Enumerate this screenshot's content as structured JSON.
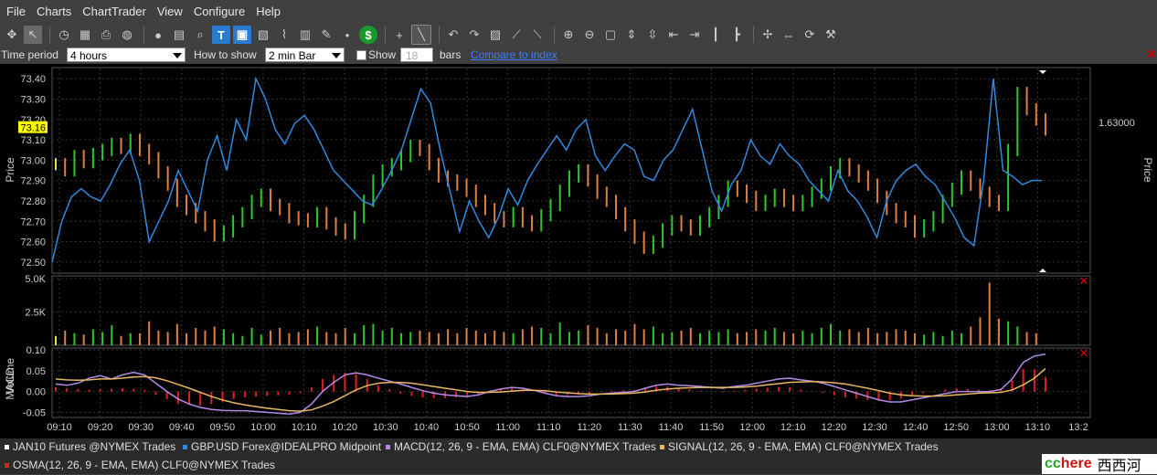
{
  "menu": [
    "File",
    "Charts",
    "ChartTrader",
    "View",
    "Configure",
    "Help"
  ],
  "toolbar_icons": [
    "crosshair-icon",
    "pointer-icon",
    "clock-icon",
    "grid-icon",
    "printer-icon",
    "globe-icon",
    "circle-icon",
    "calendar-icon",
    "magnifier-icon",
    "text-tool-icon",
    "chart-settings-icon",
    "image-icon",
    "line-chart-icon",
    "table-icon",
    "pen-icon",
    "dot-icon",
    "dollar-icon",
    "plus-icon",
    "draw-line-icon",
    "undo-icon",
    "redo-icon",
    "chart-icon",
    "tool-a-icon",
    "tool-b-icon",
    "zoom-in-icon",
    "zoom-out-icon",
    "fit-icon",
    "expand-vertical-icon",
    "compress-vertical-icon",
    "bar-left-icon",
    "bar-right-icon",
    "bars-icon",
    "bars-right-icon",
    "move-icon",
    "pan-icon",
    "refresh-icon",
    "wrench-icon"
  ],
  "options": {
    "time_period_label": "Time period",
    "time_period_value": "4 hours",
    "how_to_show_label": "How to show",
    "how_to_show_value": "2 min Bar",
    "show_label": "Show",
    "show_count": "18",
    "bars_label": "bars",
    "compare_link": "Compare to index"
  },
  "chart_data": [
    {
      "type": "bar",
      "panel": "price",
      "ylabel": "Price",
      "right_ylabel": "Price",
      "ylim": [
        72.45,
        73.45
      ],
      "yticks": [
        "73.40",
        "73.30",
        "73.20",
        "73.10",
        "73.00",
        "72.90",
        "72.80",
        "72.70",
        "72.60",
        "72.50"
      ],
      "last_price": "73.16",
      "right_axis_label": "1.63000",
      "xticks": [
        "09:10",
        "09:20",
        "09:30",
        "09:40",
        "09:50",
        "10:00",
        "10:10",
        "10:20",
        "10:30",
        "10:40",
        "10:50",
        "11:00",
        "11:10",
        "11:20",
        "11:30",
        "11:40",
        "11:50",
        "12:00",
        "12:10",
        "12:20",
        "12:30",
        "12:40",
        "12:50",
        "13:00",
        "13:10",
        "13:2"
      ],
      "series": [
        {
          "name": "JAN10 Futures @NYMEX Trades",
          "type": "bar",
          "values": [
            72.98,
            72.95,
            73.02,
            72.99,
            73.03,
            73.05,
            73.08,
            73.06,
            73.1,
            73.05,
            73.01,
            72.94,
            72.88,
            72.8,
            72.76,
            72.72,
            72.68,
            72.63,
            72.65,
            72.7,
            72.74,
            72.8,
            72.83,
            72.78,
            72.76,
            72.72,
            72.71,
            72.7,
            72.74,
            72.69,
            72.66,
            72.64,
            72.72,
            72.8,
            72.9,
            72.95,
            72.98,
            73.02,
            73.07,
            73.05,
            72.98,
            72.92,
            72.9,
            72.88,
            72.85,
            72.8,
            72.76,
            72.72,
            72.7,
            72.74,
            72.7,
            72.68,
            72.73,
            72.78,
            72.85,
            72.92,
            72.95,
            72.9,
            72.84,
            72.8,
            72.74,
            72.68,
            72.62,
            72.57,
            72.6,
            72.66,
            72.7,
            72.68,
            72.66,
            72.7,
            72.74,
            72.8,
            72.87,
            72.85,
            72.82,
            72.78,
            72.8,
            72.83,
            72.8,
            72.78,
            72.8,
            72.84,
            72.88,
            72.94,
            72.98,
            72.95,
            72.92,
            72.88,
            72.82,
            72.76,
            72.72,
            72.7,
            72.65,
            72.68,
            72.72,
            72.8,
            72.86,
            72.92,
            72.88,
            72.84,
            72.8,
            72.78,
            73.05,
            73.33,
            73.25,
            73.2,
            73.15
          ]
        },
        {
          "name": "GBP.USD Forex@IDEALPRO Midpoint",
          "type": "line",
          "values": [
            72.5,
            72.7,
            72.82,
            72.86,
            72.82,
            72.8,
            72.88,
            72.98,
            73.05,
            72.9,
            72.6,
            72.7,
            72.8,
            72.95,
            72.85,
            72.75,
            73.0,
            73.12,
            72.95,
            73.2,
            73.1,
            73.4,
            73.3,
            73.15,
            73.08,
            73.18,
            73.22,
            73.15,
            73.05,
            72.95,
            72.9,
            72.85,
            72.8,
            72.78,
            72.86,
            72.95,
            73.05,
            73.2,
            73.35,
            73.28,
            73.05,
            72.85,
            72.65,
            72.8,
            72.7,
            72.62,
            72.72,
            72.86,
            72.78,
            72.9,
            72.98,
            73.05,
            73.12,
            73.05,
            73.15,
            73.2,
            73.02,
            72.95,
            73.02,
            73.08,
            73.05,
            72.92,
            72.9,
            73.0,
            73.05,
            73.15,
            73.25,
            73.05,
            72.85,
            72.75,
            72.88,
            72.95,
            73.1,
            73.02,
            72.98,
            73.08,
            73.02,
            72.98,
            72.9,
            72.85,
            72.8,
            72.95,
            72.85,
            72.8,
            72.72,
            72.62,
            72.8,
            72.9,
            72.95,
            72.98,
            72.92,
            72.88,
            72.8,
            72.72,
            72.62,
            72.58,
            72.9,
            73.4,
            72.95,
            72.92,
            72.88,
            72.9,
            72.9
          ]
        }
      ]
    },
    {
      "type": "bar",
      "panel": "volume",
      "ylabel": "Volume",
      "ylim": [
        0,
        5000
      ],
      "yticks": [
        "5.0K",
        "2.5K"
      ],
      "series": [
        {
          "name": "Volume",
          "values": [
            700,
            1100,
            900,
            800,
            1200,
            1000,
            1500,
            700,
            900,
            900,
            1800,
            1100,
            1000,
            1600,
            900,
            1300,
            1100,
            1400,
            1200,
            900,
            700,
            1300,
            800,
            1100,
            1300,
            900,
            1000,
            1200,
            1400,
            1000,
            900,
            1300,
            900,
            1500,
            1600,
            1100,
            1300,
            900,
            1000,
            1100,
            1000,
            900,
            1200,
            900,
            1300,
            1100,
            900,
            1100,
            1000,
            900,
            1200,
            1400,
            1300,
            900,
            1700,
            1000,
            1100,
            1500,
            1300,
            900,
            1200,
            1100,
            1600,
            1200,
            1400,
            900,
            1000,
            1100,
            1300,
            900,
            1100,
            1000,
            1200,
            900,
            1000,
            1200,
            1100,
            1300,
            1000,
            900,
            1100,
            900,
            1300,
            1600,
            1100,
            1200,
            1000,
            1300,
            900,
            1000,
            1200,
            1100,
            900,
            800,
            1000,
            700,
            1100,
            900,
            1400,
            2100,
            4700,
            2000,
            1800,
            1400,
            1000,
            900
          ]
        }
      ]
    },
    {
      "type": "line",
      "panel": "macd",
      "ylabel": "MACD",
      "ylim": [
        -0.06,
        0.1
      ],
      "yticks": [
        "0.10",
        "0.05",
        "0.00",
        "-0.05"
      ],
      "series": [
        {
          "name": "MACD(12, 26, 9 - EMA, EMA) CLF0@NYMEX Trades",
          "values": [
            0.018,
            0.015,
            0.02,
            0.032,
            0.038,
            0.03,
            0.04,
            0.046,
            0.04,
            0.02,
            0.0,
            -0.018,
            -0.03,
            -0.038,
            -0.043,
            -0.045,
            -0.046,
            -0.046,
            -0.048,
            -0.05,
            -0.052,
            -0.054,
            -0.05,
            -0.03,
            0.0,
            0.022,
            0.04,
            0.045,
            0.04,
            0.032,
            0.025,
            0.018,
            0.01,
            0.002,
            -0.004,
            -0.008,
            -0.01,
            -0.012,
            -0.008,
            0.0,
            0.006,
            0.01,
            0.008,
            0.003,
            -0.004,
            -0.01,
            -0.012,
            -0.012,
            -0.01,
            -0.006,
            -0.004,
            -0.002,
            0.0,
            0.008,
            0.015,
            0.018,
            0.015,
            0.014,
            0.012,
            0.01,
            0.008,
            0.012,
            0.015,
            0.02,
            0.025,
            0.03,
            0.032,
            0.028,
            0.025,
            0.02,
            0.012,
            0.004,
            -0.004,
            -0.012,
            -0.02,
            -0.025,
            -0.025,
            -0.02,
            -0.015,
            -0.01,
            -0.005,
            0.0,
            0.0,
            0.0,
            0.0,
            0.005,
            0.03,
            0.07,
            0.085,
            0.09
          ]
        },
        {
          "name": "SIGNAL(12, 26, 9 - EMA, EMA) CLF0@NYMEX Trades",
          "values": [
            0.03,
            0.028,
            0.027,
            0.028,
            0.03,
            0.03,
            0.032,
            0.035,
            0.036,
            0.033,
            0.026,
            0.017,
            0.008,
            -0.002,
            -0.012,
            -0.02,
            -0.027,
            -0.032,
            -0.036,
            -0.04,
            -0.043,
            -0.046,
            -0.047,
            -0.044,
            -0.035,
            -0.024,
            -0.01,
            0.004,
            0.014,
            0.02,
            0.022,
            0.022,
            0.02,
            0.016,
            0.012,
            0.008,
            0.004,
            0.0,
            -0.002,
            -0.002,
            -0.001,
            0.001,
            0.003,
            0.003,
            0.002,
            -0.001,
            -0.003,
            -0.005,
            -0.006,
            -0.006,
            -0.006,
            -0.005,
            -0.004,
            -0.001,
            0.003,
            0.006,
            0.008,
            0.009,
            0.01,
            0.01,
            0.01,
            0.01,
            0.011,
            0.013,
            0.016,
            0.019,
            0.022,
            0.023,
            0.024,
            0.023,
            0.021,
            0.018,
            0.013,
            0.008,
            0.002,
            -0.004,
            -0.008,
            -0.01,
            -0.011,
            -0.011,
            -0.01,
            -0.008,
            -0.006,
            -0.004,
            -0.003,
            -0.002,
            0.004,
            0.016,
            0.032,
            0.055
          ]
        },
        {
          "name": "OSMA(12, 26, 9 - EMA, EMA) CLF0@NYMEX Trades",
          "values": [
            0.01,
            0.008,
            0.006,
            0.004,
            0.005,
            0.006,
            0.008,
            0.006,
            0.004,
            -0.008,
            -0.018,
            -0.03,
            -0.032,
            -0.034,
            -0.03,
            -0.025,
            -0.018,
            -0.014,
            -0.012,
            -0.01,
            -0.009,
            -0.008,
            -0.004,
            0.01,
            0.03,
            0.04,
            0.045,
            0.042,
            0.03,
            0.015,
            0.005,
            -0.005,
            -0.01,
            -0.014,
            -0.016,
            -0.016,
            -0.014,
            -0.012,
            -0.006,
            0.002,
            0.007,
            0.009,
            0.005,
            0.0,
            -0.006,
            -0.009,
            -0.009,
            -0.007,
            -0.004,
            0.0,
            0.002,
            0.003,
            0.004,
            0.009,
            0.012,
            0.012,
            0.007,
            0.005,
            0.002,
            0.0,
            -0.002,
            0.002,
            0.004,
            0.007,
            0.009,
            0.011,
            0.01,
            0.005,
            0.001,
            -0.003,
            -0.009,
            -0.014,
            -0.017,
            -0.02,
            -0.022,
            -0.021,
            -0.017,
            -0.01,
            -0.004,
            0.001,
            0.005,
            0.008,
            0.006,
            0.004,
            0.003,
            0.007,
            0.026,
            0.054,
            0.053,
            0.035
          ]
        }
      ]
    }
  ],
  "legend": [
    {
      "label": "JAN10 Futures @NYMEX Trades",
      "color": "#ffffff"
    },
    {
      "label": "GBP.USD Forex@IDEALPRO Midpoint",
      "color": "#2f8ae0"
    },
    {
      "label": "MACD(12, 26, 9 - EMA, EMA) CLF0@NYMEX Trades",
      "color": "#b48ae8"
    },
    {
      "label": "SIGNAL(12, 26, 9 - EMA, EMA) CLF0@NYMEX Trades",
      "color": "#e8b860"
    },
    {
      "label": "OSMA(12, 26, 9 - EMA, EMA) CLF0@NYMEX Trades",
      "color": "#e02020"
    }
  ],
  "watermark": {
    "cc": "cc",
    "here": "here",
    "cn": "西西河"
  },
  "colors": {
    "up": "#2ec82e",
    "down": "#e08040",
    "neutral": "#e8e040",
    "price_line": "#2f8ae0",
    "grid": "#555555"
  }
}
